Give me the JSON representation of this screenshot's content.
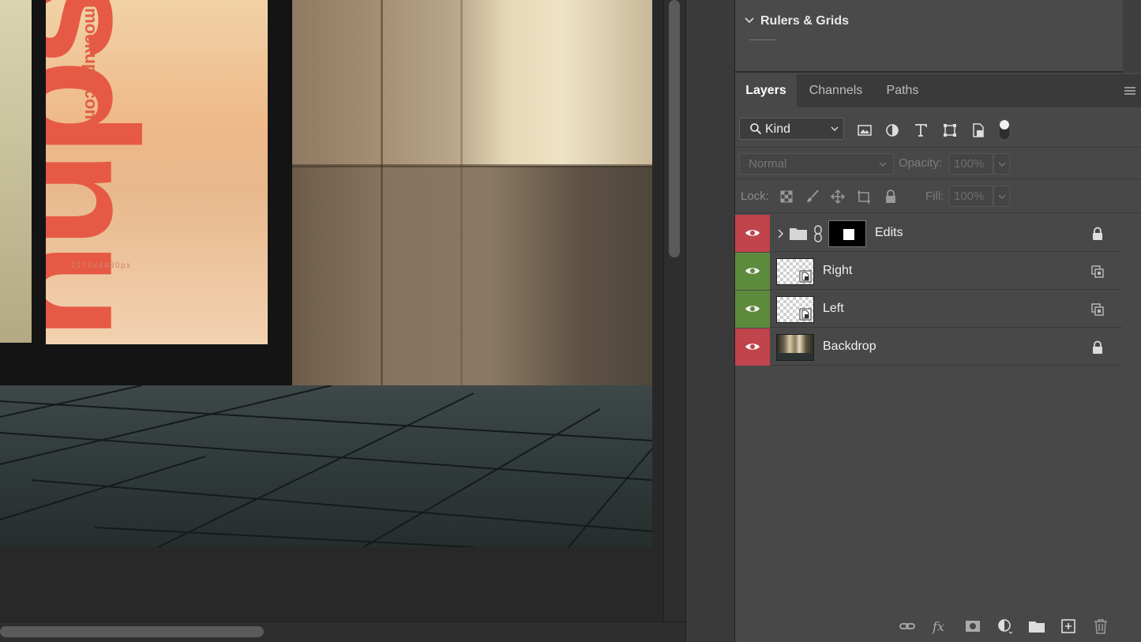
{
  "canvas": {
    "poster_text": "sdnu",
    "poster_url": "lmockups.com",
    "poster_size": "2170x4480px"
  },
  "rulers_panel": {
    "title": "Rulers & Grids"
  },
  "tabs": [
    {
      "label": "Layers",
      "active": true
    },
    {
      "label": "Channels",
      "active": false
    },
    {
      "label": "Paths",
      "active": false
    }
  ],
  "filter": {
    "kind_label": "Kind",
    "icons": [
      "image-filter-icon",
      "adjustment-filter-icon",
      "type-filter-icon",
      "shape-filter-icon",
      "smart-object-filter-icon",
      "filter-toggle-icon"
    ]
  },
  "blend": {
    "mode": "Normal",
    "opacity_label": "Opacity:",
    "opacity_value": "100%"
  },
  "lock": {
    "label": "Lock:",
    "fill_label": "Fill:",
    "fill_value": "100%"
  },
  "layers": [
    {
      "name": "Edits",
      "eye_color": "#c1434b",
      "type": "group",
      "badge": "lock-icon"
    },
    {
      "name": "Right",
      "eye_color": "#5d8b3e",
      "type": "smart-object",
      "badge": "smart-object-badge-icon"
    },
    {
      "name": "Left",
      "eye_color": "#5d8b3e",
      "type": "smart-object",
      "badge": "smart-object-badge-icon"
    },
    {
      "name": "Backdrop",
      "eye_color": "#c1434b",
      "type": "image",
      "badge": "lock-icon"
    }
  ],
  "bottom_icons": [
    "link-layers-icon",
    "fx-icon",
    "add-mask-icon",
    "new-adjustment-icon",
    "new-group-icon",
    "new-layer-icon",
    "delete-layer-icon"
  ]
}
